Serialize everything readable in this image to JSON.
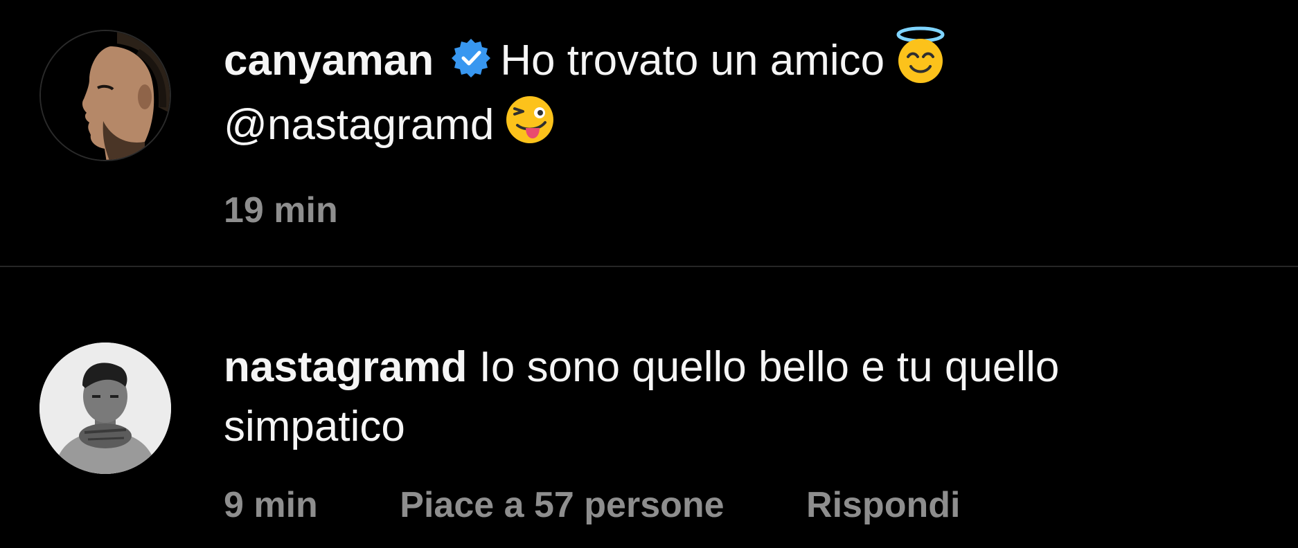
{
  "comments": [
    {
      "username": "canyaman",
      "verified": true,
      "verified_icon": "verified-badge-icon",
      "text": "Ho trovato un amico",
      "emoji_1": "smiling-face-with-halo-icon",
      "mention": "@nastagramd",
      "emoji_2": "winking-face-with-tongue-icon",
      "time": "19 min"
    },
    {
      "username": "nastagramd",
      "verified": false,
      "text": "Io sono quello bello e tu quello simpatico",
      "time": "9 min",
      "likes": "Piace a 57 persone",
      "reply": "Rispondi"
    }
  ],
  "colors": {
    "background": "#000000",
    "text": "#f5f5f5",
    "secondary_text": "#8e8e8e",
    "verified_blue": "#3897f0",
    "divider": "#262626"
  }
}
